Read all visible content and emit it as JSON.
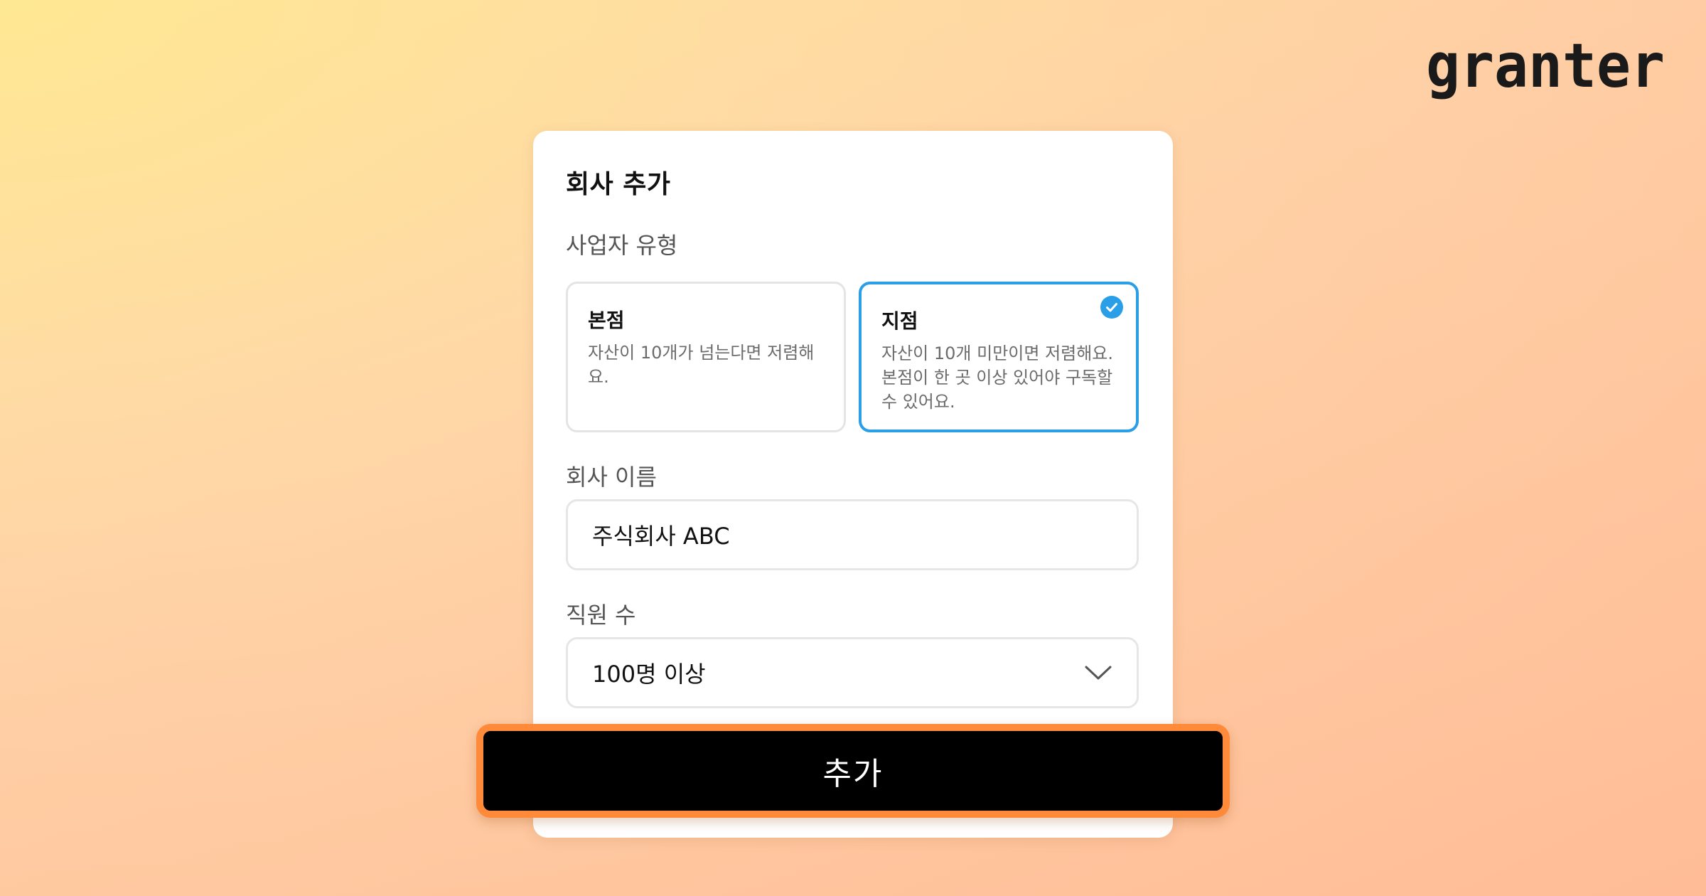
{
  "brand": {
    "logo_text": "granter"
  },
  "form": {
    "title": "회사 추가",
    "business_type": {
      "label": "사업자 유형",
      "options": [
        {
          "title": "본점",
          "description": "자산이 10개가 넘는다면 저렴해요.",
          "selected": false
        },
        {
          "title": "지점",
          "description": "자산이 10개 미만이면 저렴해요.\n본점이 한 곳 이상 있어야 구독할\n수 있어요.",
          "selected": true
        }
      ]
    },
    "company_name": {
      "label": "회사 이름",
      "value": "주식회사 ABC"
    },
    "employees": {
      "label": "직원 수",
      "selected": "100명 이상"
    },
    "submit_label": "추가"
  },
  "colors": {
    "accent": "#2b9ee8",
    "button_bg": "#000000",
    "button_border": "#ff8a3a"
  },
  "icons": {
    "selected": "check-circle-icon",
    "dropdown": "chevron-down-icon"
  }
}
